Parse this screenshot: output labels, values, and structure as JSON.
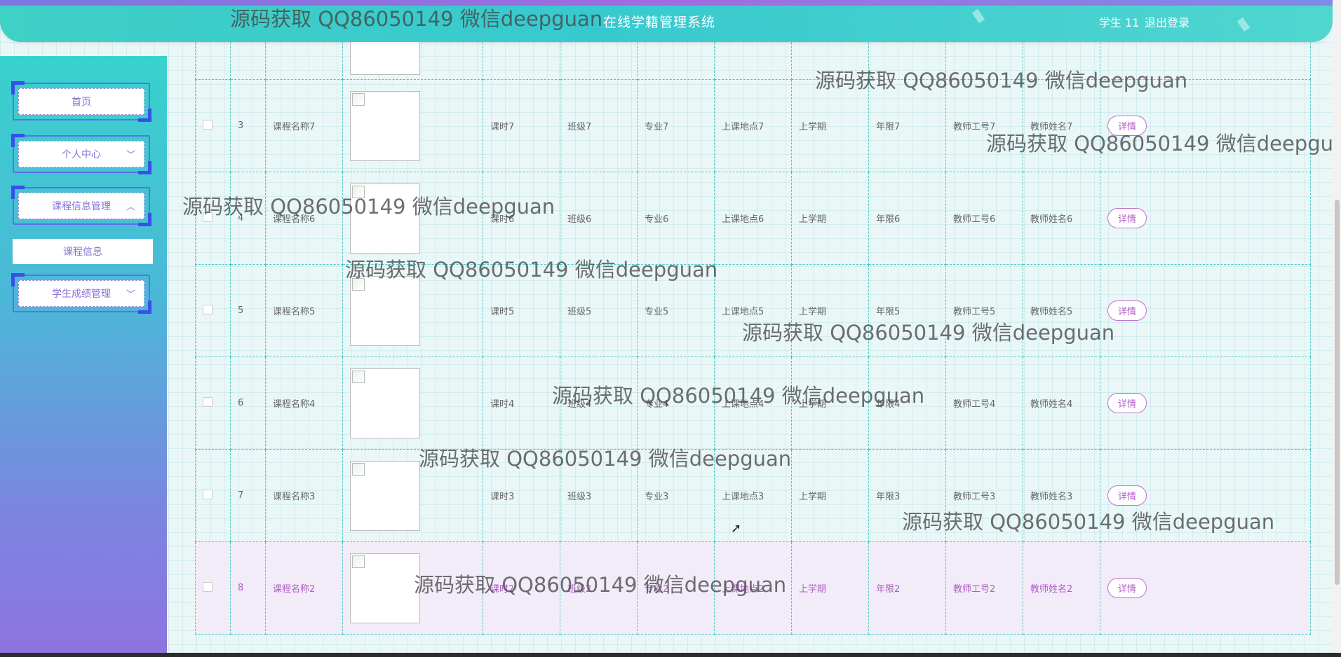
{
  "header": {
    "title": "在线学籍管理系统",
    "user": "学生 11",
    "logout": "退出登录"
  },
  "sidebar": {
    "items": [
      {
        "label": "首页",
        "chevron": ""
      },
      {
        "label": "个人中心",
        "chevron": "﹀"
      },
      {
        "label": "课程信息管理",
        "chevron": "︿"
      },
      {
        "label": "学生成绩管理",
        "chevron": "﹀"
      }
    ],
    "sub_item": "课程信息"
  },
  "table": {
    "detail_label": "详情",
    "rows": [
      {
        "index": "",
        "name": "",
        "hours": "",
        "class": "",
        "major": "",
        "location": "",
        "term": "",
        "years": "",
        "teacher_id": "",
        "teacher_name": ""
      },
      {
        "index": "3",
        "name": "课程名称7",
        "hours": "课时7",
        "class": "班级7",
        "major": "专业7",
        "location": "上课地点7",
        "term": "上学期",
        "years": "年限7",
        "teacher_id": "教师工号7",
        "teacher_name": "教师姓名7"
      },
      {
        "index": "4",
        "name": "课程名称6",
        "hours": "课时6",
        "class": "班级6",
        "major": "专业6",
        "location": "上课地点6",
        "term": "上学期",
        "years": "年限6",
        "teacher_id": "教师工号6",
        "teacher_name": "教师姓名6"
      },
      {
        "index": "5",
        "name": "课程名称5",
        "hours": "课时5",
        "class": "班级5",
        "major": "专业5",
        "location": "上课地点5",
        "term": "上学期",
        "years": "年限5",
        "teacher_id": "教师工号5",
        "teacher_name": "教师姓名5"
      },
      {
        "index": "6",
        "name": "课程名称4",
        "hours": "课时4",
        "class": "班级4",
        "major": "专业4",
        "location": "上课地点4",
        "term": "上学期",
        "years": "年限4",
        "teacher_id": "教师工号4",
        "teacher_name": "教师姓名4"
      },
      {
        "index": "7",
        "name": "课程名称3",
        "hours": "课时3",
        "class": "班级3",
        "major": "专业3",
        "location": "上课地点3",
        "term": "上学期",
        "years": "年限3",
        "teacher_id": "教师工号3",
        "teacher_name": "教师姓名3"
      },
      {
        "index": "8",
        "name": "课程名称2",
        "hours": "课时2",
        "class": "班级2",
        "major": "专业2",
        "location": "上课地点2",
        "term": "上学期",
        "years": "年限2",
        "teacher_id": "教师工号2",
        "teacher_name": "教师姓名2"
      }
    ]
  },
  "watermark": "源码获取 QQ86050149 微信deepguan",
  "colors": {
    "header_teal": "#3fd0c6",
    "accent_purple": "#b058c8",
    "grid_line": "#48c7c5",
    "highlight_row": "#f2ecf8"
  }
}
